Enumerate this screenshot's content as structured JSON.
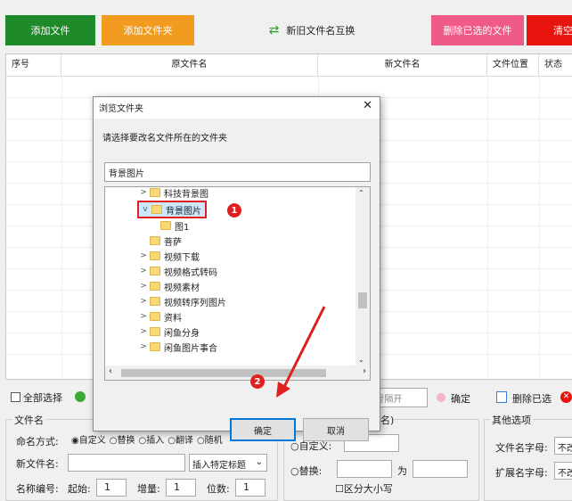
{
  "toolbar": {
    "add_file": "添加文件",
    "add_folder": "添加文件夹",
    "swap": "新旧文件名互换",
    "delete_selected": "删除已选的文件",
    "clear": "清空"
  },
  "table": {
    "headers": [
      "序号",
      "原文件名",
      "新文件名",
      "文件位置",
      "状态"
    ]
  },
  "bottom": {
    "select_all": "全部选择",
    "separator_hint": "|号隔开",
    "confirm": "确定",
    "delete_selected": "删除已选",
    "filename_group": "文件名",
    "naming_mode_label": "命名方式:",
    "modes": [
      "自定义",
      "替换",
      "插入",
      "翻译",
      "随机"
    ],
    "new_filename_label": "新文件名:",
    "insert_title": "插入特定标题",
    "numbering_label": "名称编号:",
    "start_label": "起始:",
    "start_value": "1",
    "increment_label": "增量:",
    "increment_value": "1",
    "digits_label": "位数:",
    "digits_value": "1",
    "ext_group_suffix": "名)",
    "custom_label": "自定义:",
    "replace_label": "替换:",
    "as_label": "为",
    "case_label": "区分大小写",
    "other_group": "其他选项",
    "filename_letters": "文件名字母:",
    "ext_letters": "扩展名字母:",
    "letters_value_1": "不改",
    "letters_value_2": "不改"
  },
  "dialog": {
    "title": "浏览文件夹",
    "prompt": "请选择要改名文件所在的文件夹",
    "path_value": "背景图片",
    "tree": [
      {
        "label": "科技背景图",
        "chev": ">",
        "indent": 1
      },
      {
        "label": "背景图片",
        "chev": "v",
        "indent": 1
      },
      {
        "label": "图1",
        "chev": "",
        "indent": 2
      },
      {
        "label": "菩萨",
        "chev": "",
        "indent": 1
      },
      {
        "label": "视频下载",
        "chev": ">",
        "indent": 1
      },
      {
        "label": "视频格式转码",
        "chev": ">",
        "indent": 1
      },
      {
        "label": "视频素材",
        "chev": ">",
        "indent": 1
      },
      {
        "label": "视频转序列图片",
        "chev": ">",
        "indent": 1
      },
      {
        "label": "资料",
        "chev": ">",
        "indent": 1
      },
      {
        "label": "闲鱼分身",
        "chev": ">",
        "indent": 1
      },
      {
        "label": "闲鱼图片事合",
        "chev": ">",
        "indent": 1
      }
    ],
    "ok": "确定",
    "cancel": "取消",
    "annotation_1": "1",
    "annotation_2": "2"
  },
  "colors": {
    "green": "#1e8a2a",
    "orange": "#f29c1f",
    "pink": "#ef5a86",
    "red": "#e8150e",
    "annotation": "#e02020"
  }
}
